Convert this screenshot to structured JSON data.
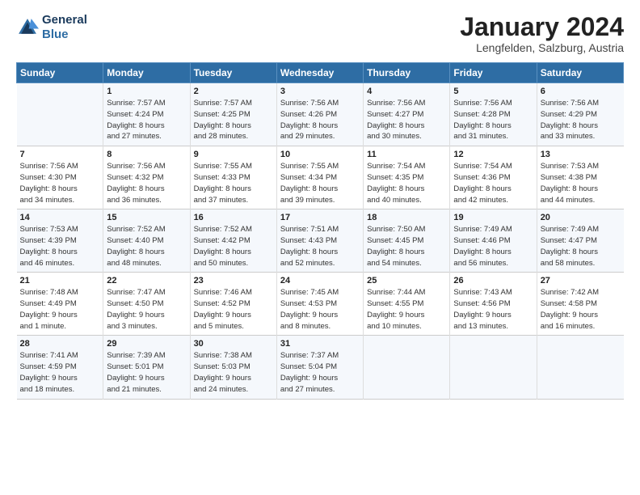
{
  "header": {
    "logo_line1": "General",
    "logo_line2": "Blue",
    "title": "January 2024",
    "subtitle": "Lengfelden, Salzburg, Austria"
  },
  "columns": [
    "Sunday",
    "Monday",
    "Tuesday",
    "Wednesday",
    "Thursday",
    "Friday",
    "Saturday"
  ],
  "rows": [
    [
      {
        "num": "",
        "info": ""
      },
      {
        "num": "1",
        "info": "Sunrise: 7:57 AM\nSunset: 4:24 PM\nDaylight: 8 hours\nand 27 minutes."
      },
      {
        "num": "2",
        "info": "Sunrise: 7:57 AM\nSunset: 4:25 PM\nDaylight: 8 hours\nand 28 minutes."
      },
      {
        "num": "3",
        "info": "Sunrise: 7:56 AM\nSunset: 4:26 PM\nDaylight: 8 hours\nand 29 minutes."
      },
      {
        "num": "4",
        "info": "Sunrise: 7:56 AM\nSunset: 4:27 PM\nDaylight: 8 hours\nand 30 minutes."
      },
      {
        "num": "5",
        "info": "Sunrise: 7:56 AM\nSunset: 4:28 PM\nDaylight: 8 hours\nand 31 minutes."
      },
      {
        "num": "6",
        "info": "Sunrise: 7:56 AM\nSunset: 4:29 PM\nDaylight: 8 hours\nand 33 minutes."
      }
    ],
    [
      {
        "num": "7",
        "info": "Sunrise: 7:56 AM\nSunset: 4:30 PM\nDaylight: 8 hours\nand 34 minutes."
      },
      {
        "num": "8",
        "info": "Sunrise: 7:56 AM\nSunset: 4:32 PM\nDaylight: 8 hours\nand 36 minutes."
      },
      {
        "num": "9",
        "info": "Sunrise: 7:55 AM\nSunset: 4:33 PM\nDaylight: 8 hours\nand 37 minutes."
      },
      {
        "num": "10",
        "info": "Sunrise: 7:55 AM\nSunset: 4:34 PM\nDaylight: 8 hours\nand 39 minutes."
      },
      {
        "num": "11",
        "info": "Sunrise: 7:54 AM\nSunset: 4:35 PM\nDaylight: 8 hours\nand 40 minutes."
      },
      {
        "num": "12",
        "info": "Sunrise: 7:54 AM\nSunset: 4:36 PM\nDaylight: 8 hours\nand 42 minutes."
      },
      {
        "num": "13",
        "info": "Sunrise: 7:53 AM\nSunset: 4:38 PM\nDaylight: 8 hours\nand 44 minutes."
      }
    ],
    [
      {
        "num": "14",
        "info": "Sunrise: 7:53 AM\nSunset: 4:39 PM\nDaylight: 8 hours\nand 46 minutes."
      },
      {
        "num": "15",
        "info": "Sunrise: 7:52 AM\nSunset: 4:40 PM\nDaylight: 8 hours\nand 48 minutes."
      },
      {
        "num": "16",
        "info": "Sunrise: 7:52 AM\nSunset: 4:42 PM\nDaylight: 8 hours\nand 50 minutes."
      },
      {
        "num": "17",
        "info": "Sunrise: 7:51 AM\nSunset: 4:43 PM\nDaylight: 8 hours\nand 52 minutes."
      },
      {
        "num": "18",
        "info": "Sunrise: 7:50 AM\nSunset: 4:45 PM\nDaylight: 8 hours\nand 54 minutes."
      },
      {
        "num": "19",
        "info": "Sunrise: 7:49 AM\nSunset: 4:46 PM\nDaylight: 8 hours\nand 56 minutes."
      },
      {
        "num": "20",
        "info": "Sunrise: 7:49 AM\nSunset: 4:47 PM\nDaylight: 8 hours\nand 58 minutes."
      }
    ],
    [
      {
        "num": "21",
        "info": "Sunrise: 7:48 AM\nSunset: 4:49 PM\nDaylight: 9 hours\nand 1 minute."
      },
      {
        "num": "22",
        "info": "Sunrise: 7:47 AM\nSunset: 4:50 PM\nDaylight: 9 hours\nand 3 minutes."
      },
      {
        "num": "23",
        "info": "Sunrise: 7:46 AM\nSunset: 4:52 PM\nDaylight: 9 hours\nand 5 minutes."
      },
      {
        "num": "24",
        "info": "Sunrise: 7:45 AM\nSunset: 4:53 PM\nDaylight: 9 hours\nand 8 minutes."
      },
      {
        "num": "25",
        "info": "Sunrise: 7:44 AM\nSunset: 4:55 PM\nDaylight: 9 hours\nand 10 minutes."
      },
      {
        "num": "26",
        "info": "Sunrise: 7:43 AM\nSunset: 4:56 PM\nDaylight: 9 hours\nand 13 minutes."
      },
      {
        "num": "27",
        "info": "Sunrise: 7:42 AM\nSunset: 4:58 PM\nDaylight: 9 hours\nand 16 minutes."
      }
    ],
    [
      {
        "num": "28",
        "info": "Sunrise: 7:41 AM\nSunset: 4:59 PM\nDaylight: 9 hours\nand 18 minutes."
      },
      {
        "num": "29",
        "info": "Sunrise: 7:39 AM\nSunset: 5:01 PM\nDaylight: 9 hours\nand 21 minutes."
      },
      {
        "num": "30",
        "info": "Sunrise: 7:38 AM\nSunset: 5:03 PM\nDaylight: 9 hours\nand 24 minutes."
      },
      {
        "num": "31",
        "info": "Sunrise: 7:37 AM\nSunset: 5:04 PM\nDaylight: 9 hours\nand 27 minutes."
      },
      {
        "num": "",
        "info": ""
      },
      {
        "num": "",
        "info": ""
      },
      {
        "num": "",
        "info": ""
      }
    ]
  ]
}
